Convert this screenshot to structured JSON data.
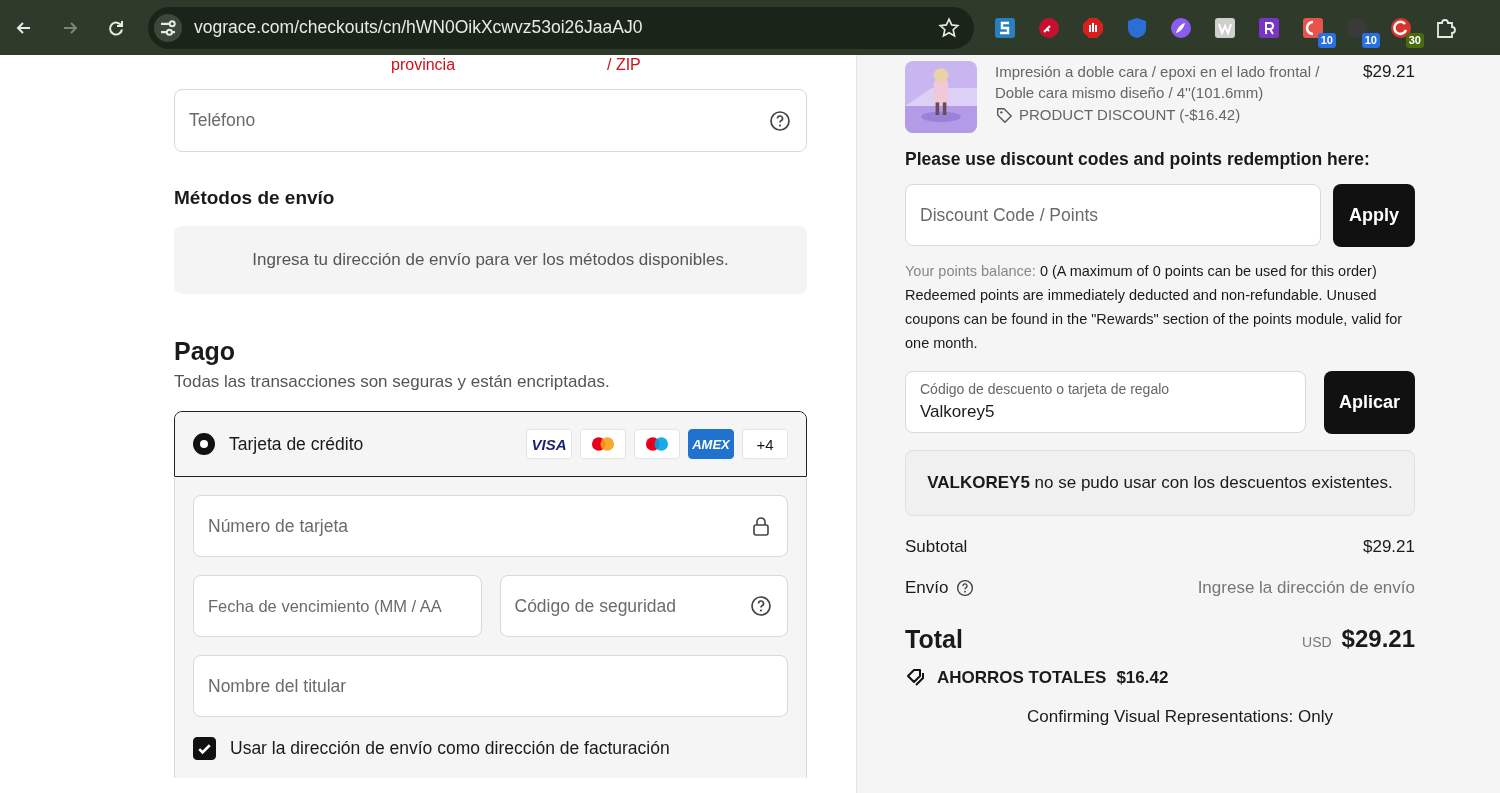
{
  "browser": {
    "url": "vograce.com/checkouts/cn/hWN0OikXcwvz53oi26JaaAJ0",
    "forward_disabled": true,
    "extensions": [
      {
        "kind": "s",
        "color": "#2a7fc0"
      },
      {
        "kind": "key",
        "color": "#c8102e"
      },
      {
        "kind": "hand",
        "color": "#d81e1e"
      },
      {
        "kind": "shield",
        "color": "#2a6fd6"
      },
      {
        "kind": "feather",
        "color": "#8c5cf0"
      },
      {
        "kind": "w",
        "color": "#cfcfcf"
      },
      {
        "kind": "r",
        "color": "#7a35c8"
      },
      {
        "kind": "tile",
        "color": "#e8534a",
        "badge": "10"
      },
      {
        "kind": "dark",
        "color": "#3a3a3a",
        "badge": "10"
      },
      {
        "kind": "red",
        "color": "#d8342c",
        "badge": "30"
      }
    ]
  },
  "address_cut": {
    "errors": [
      "provincia",
      "/ ZIP"
    ]
  },
  "phone": {
    "placeholder": "Teléfono"
  },
  "shipping": {
    "title": "Métodos de envío",
    "message": "Ingresa tu dirección de envío para ver los métodos disponibles."
  },
  "payment": {
    "title": "Pago",
    "subtitle": "Todas las transacciones son seguras y están encriptadas.",
    "methods": [
      {
        "label": "Tarjeta de crédito",
        "selected": true,
        "brands": [
          {
            "kind": "visa",
            "label": "VISA"
          },
          {
            "kind": "mastercard"
          },
          {
            "kind": "maestro"
          },
          {
            "kind": "amex",
            "label": "AMEX"
          },
          {
            "kind": "more",
            "label": "+4"
          }
        ]
      }
    ],
    "card_number": {
      "placeholder": "Número de tarjeta"
    },
    "expiry": {
      "placeholder": "Fecha de vencimiento (MM / AA"
    },
    "cvv": {
      "placeholder": "Código de seguridad"
    },
    "holder": {
      "placeholder": "Nombre del titular"
    },
    "billing_same": {
      "label": "Usar la dirección de envío como dirección de facturación",
      "checked": true
    }
  },
  "summary": {
    "item": {
      "lines": [
        "Impresión a doble cara / epoxi en el lado frontal /",
        "Doble cara mismo diseño / 4''(101.6mm)"
      ],
      "price": "$29.21",
      "discount": "PRODUCT DISCOUNT (-$16.42)"
    },
    "points_heading": "Please use discount codes and points redemption here:",
    "points_field": {
      "placeholder": "Discount Code / Points"
    },
    "apply": "Apply",
    "points_label": "Your points balance:",
    "points_value": "0 (A maximum of 0 points can be used for this order)",
    "points_note": "Redeemed points are immediately deducted and non-refundable. Unused coupons can be found in the \"Rewards\" section of the points module, valid for one month.",
    "gift_field": {
      "label": "Código de descuento o tarjeta de regalo",
      "value": "Valkorey5"
    },
    "gift_apply": "Aplicar",
    "notice": "**VALKOREY5** no se pudo usar con los descuentos existentes.",
    "subtotal": {
      "label": "Subtotal",
      "value": "$29.21"
    },
    "shipping": {
      "label": "Envío",
      "value": "Ingrese la dirección de envío"
    },
    "total": {
      "label": "Total",
      "currency": "USD",
      "value": "$29.21"
    },
    "savings": {
      "label": "AHORROS TOTALES",
      "value": "$16.42"
    },
    "footer": "Confirming Visual Representations: Only"
  }
}
